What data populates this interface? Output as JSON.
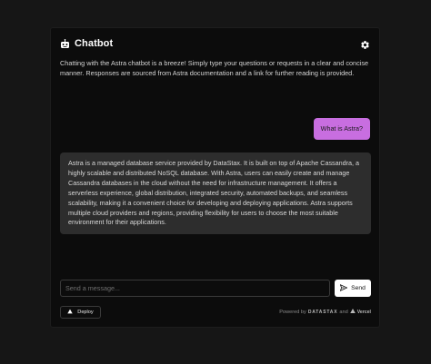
{
  "header": {
    "title": "Chatbot",
    "icon": "robot-icon",
    "settings_icon": "gear-icon"
  },
  "intro_text": "Chatting with the Astra chatbot is a breeze! Simply type your questions or requests in a clear and concise manner. Responses are sourced from Astra documentation and a link for further reading is provided.",
  "messages": [
    {
      "role": "user",
      "text": "What is Astra?"
    },
    {
      "role": "assistant",
      "text": "Astra is a managed database service provided by DataStax. It is built on top of Apache Cassandra, a highly scalable and distributed NoSQL database. With Astra, users can easily create and manage Cassandra databases in the cloud without the need for infrastructure management. It offers a serverless experience, global distribution, integrated security, automated backups, and seamless scalability, making it a convenient choice for developing and deploying applications. Astra supports multiple cloud providers and regions, providing flexibility for users to choose the most suitable environment for their applications."
    }
  ],
  "input": {
    "placeholder": "Send a message...",
    "value": ""
  },
  "send_button": {
    "label": "Send",
    "icon": "send-icon"
  },
  "deploy_button": {
    "label": "Deploy",
    "icon": "triangle-up-icon"
  },
  "footer": {
    "powered_by": "Powered by",
    "brand_1": "DATASTAX",
    "and": "and",
    "brand_2": "Vercel",
    "vercel_icon": "vercel-triangle-icon"
  },
  "colors": {
    "background": "#161616",
    "panel": "#0c0c0c",
    "user_bubble": "#c86ee0",
    "assistant_bubble": "#2d2d2d"
  }
}
